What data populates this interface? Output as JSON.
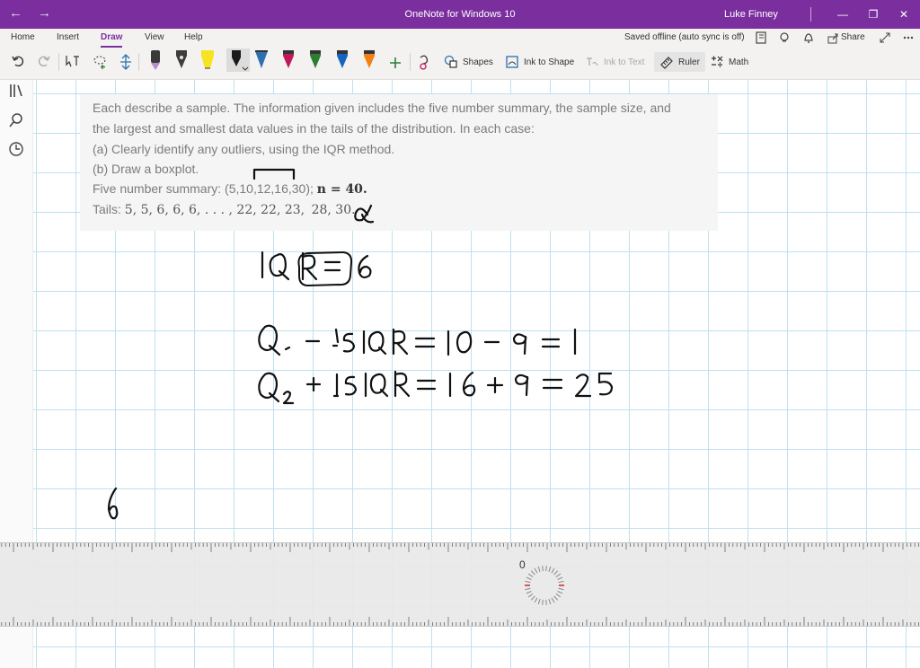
{
  "titlebar": {
    "title": "OneNote for Windows 10",
    "user": "Luke Finney",
    "back_icon": "back-arrow-icon",
    "forward_icon": "forward-arrow-icon",
    "bg_color": "#7b2f9e"
  },
  "ribbon": {
    "tabs": [
      {
        "label": "Home"
      },
      {
        "label": "Insert"
      },
      {
        "label": "Draw",
        "active": true
      },
      {
        "label": "View"
      },
      {
        "label": "Help"
      }
    ],
    "status": "Saved offline (auto sync is off)",
    "share_label": "Share",
    "tools": {
      "shapes": "Shapes",
      "ink_to_shape": "Ink to Shape",
      "ink_to_text": "Ink to Text",
      "ruler": "Ruler",
      "math": "Math"
    },
    "pen_colors": [
      "#b58ccc",
      "#3d3d3d",
      "#f6e323",
      "#1a1a1a",
      "#2e6fb0",
      "#c2185b",
      "#2e7d32",
      "#1565c0",
      "#f57f17"
    ]
  },
  "question": {
    "line1": "Each describe a sample. The information given includes the five number summary, the sample size, and",
    "line2": "the largest and smallest data values in the tails of the distribution. In each case:",
    "line3": "(a) Clearly identify any outliers, using the IQR method.",
    "line4": "(b) Draw a boxplot.",
    "five_prefix": "Five number summary: (5,10,12,16,30); ",
    "five_n": "n = 40.",
    "tails_prefix": "Tails: ",
    "tails_values": "5, 5, 6, 6, 6, . . . , 22, 22, 23, ",
    "tails_circled": "28, 30."
  },
  "ruler": {
    "zero_label": "0"
  }
}
